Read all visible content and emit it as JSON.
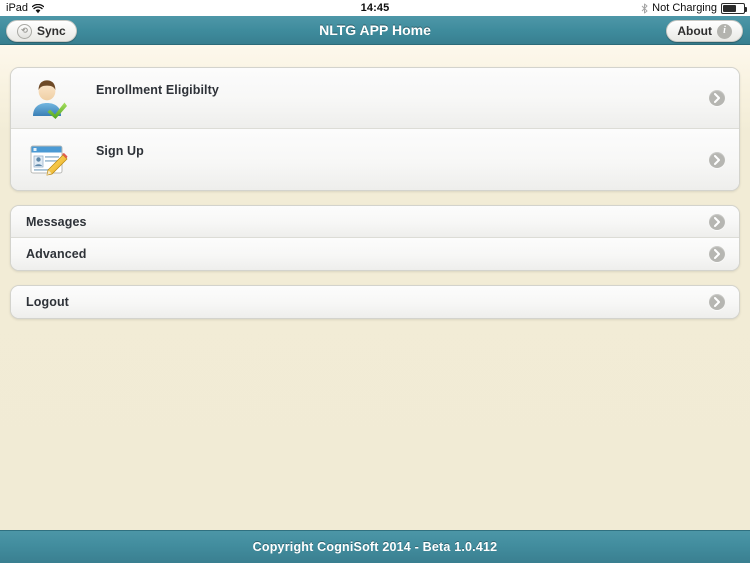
{
  "status_bar": {
    "device": "iPad",
    "wifi_icon": "wifi-icon",
    "time": "14:45",
    "bluetooth_icon": "bluetooth-icon",
    "power_state": "Not Charging",
    "battery_icon": "battery-icon"
  },
  "navbar": {
    "title": "NLTG APP Home",
    "left_button": {
      "label": "Sync",
      "icon": "sync-icon"
    },
    "right_button": {
      "label": "About",
      "icon": "info-icon"
    },
    "background_color": "#3f8c9d"
  },
  "main": {
    "groups": [
      {
        "name": "primary-actions",
        "rows": [
          {
            "label": "Enrollment Eligibilty",
            "icon": "user-check-icon",
            "disclosure": "chevron-right-icon",
            "size": "tall"
          },
          {
            "label": "Sign Up",
            "icon": "form-pencil-icon",
            "disclosure": "chevron-right-icon",
            "size": "tall"
          }
        ]
      },
      {
        "name": "secondary-actions",
        "rows": [
          {
            "label": "Messages",
            "icon": null,
            "disclosure": "chevron-right-icon",
            "size": "short"
          },
          {
            "label": "Advanced",
            "icon": null,
            "disclosure": "chevron-right-icon",
            "size": "short"
          }
        ]
      },
      {
        "name": "session-actions",
        "rows": [
          {
            "label": "Logout",
            "icon": null,
            "disclosure": "chevron-right-icon",
            "size": "short"
          }
        ]
      }
    ]
  },
  "footer": {
    "text": "Copyright CogniSoft 2014 - Beta 1.0.412",
    "background_color": "#428d9e"
  },
  "theme": {
    "page_background": "#f2ecd6",
    "accent": "#3f8c9d",
    "cell_background": "#f7f7f6",
    "text": "#2e3238"
  }
}
